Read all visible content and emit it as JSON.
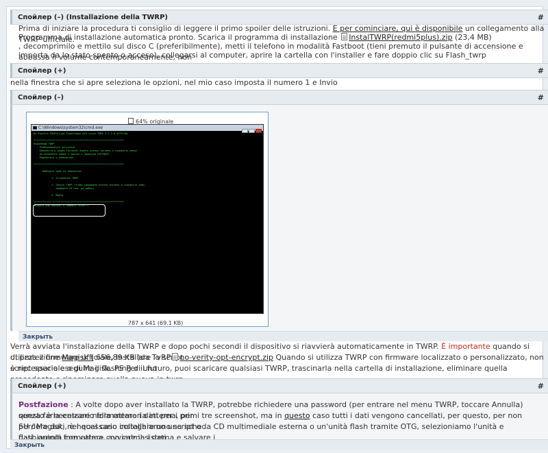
{
  "spoiler1": {
    "header": "Спойлер (–) (Installazione della TWRP)",
    "hash": "#",
    "line1_a": "Prima di iniziare la procedura ti consiglio di leggere il primo spoiler delle istruzioni. ",
    "line1_link": "E per cominciare, qui è disponibile",
    "line1_b": " un collegamento alla TWRP ufficiale.",
    "line2_a": "Programma di installazione automatica pronto. Scarica il programma di installazione ",
    "line2_file": "InstalTWRP(redmi5plus).zip",
    "line2_b": " (23,4 MB)",
    "line3": ", decomprimilo e mettilo sul disco C (preferibilmente), metti il telefono in modalità Fastboot (tieni premuto il pulsante di accensione e abbassa il volume contemporaneamente, non",
    "line4": "importa da lo stato spento o acceso), collegarsi al computer, aprire la cartella con l'installer e fare doppio clic su Flash_twrp"
  },
  "spoiler2": {
    "header": "Спойлер (+)",
    "hash": "#",
    "line1": "nella finestra che si apre seleziona le opzioni, nel mio caso imposta il numero 1 e Invio"
  },
  "spoiler3": {
    "header": "Спойлер (–)",
    "hash": "#",
    "zoom_label": "64% originale",
    "console_title": "C:\\Windows\\system32\\cmd.exe",
    "console_text": "By Faustus FDAXhinjoo Snapdragon 625 since TWRP 3.2.1-0 OFFICIAL\n\n*************************************************************\nПодробный TWRP\n  - Разблокировать загрузчик\n  - Перевести в режим Fastboot,Зажать кнопку питания и громкость минус\n    до появления зайца в ушанке с надписью FASTBOOT\n  - Подключить к компьютеру\n\n*************************************************************\n\n      Выберите один из вариантов:\n\n            1. Установить TWRP\n\n            2. Запуск TWRP (чтобы удерживая кнопки питания и громкость плюс,\n               примерно 10 сек. до вибро)\n\n            3. Выйти\n\n*************************************************************\nВведите ваш вариант и нажмите Enter:1",
    "dimensions": "787 x 641 (69.1 KB)",
    "close_label": "Закрыть"
  },
  "after_image": {
    "line1_a": "Verrà avviata l'installazione della TWRP e dopo pochi secondi il dispositivo si riavvierà automaticamente in TWRP. ",
    "line1_imp": "È importante",
    "line1_b": " quando si utilizza il firmware ufficiale, installare lo script",
    "line2_a": "di protezione ",
    "line2_magisk": "Magisk (",
    "line2_b": " 656,89 KB )da TvRP",
    "line2_file": "no-verity-opt-encrypt.zip",
    "line2_c": " Quando si utilizza TWRP con firmware localizzato o personalizzato, non è necessario eseguire il flashing di uno",
    "line3": "script speciale o di Magisk. PS Per il futuro, puoi scaricare qualsiasi TWRP, trascinarla nella cartella di installazione, eliminare quella precedente e rinominare quella nuova in twrp"
  },
  "spoiler4": {
    "header": "Спойлер (+)",
    "hash": "#",
    "postfazione": "Postfazione",
    "line1_a": " : A volte dopo aver installato la TWRP, potrebbe richiedere una password (per entrare nel menu TWRP, toccare Annulla) senza farla entrare nella memoria interna, per",
    "line2_a": "questo è necessario formattare i dati per i primi tre screenshot, ma in ",
    "line2_link": "questo",
    "line2_b": " caso tutti i dati vengono cancellati, per questo, per non perdere dati, è necessario installare uno script o",
    "line3": "SU / Magisk, nel qual caso colleghiamo una scheda CD multimediale esterna o un'unità flash tramite OTG, selezioniamo l'unità e flashiamola con calma, avviare il sistema e salvare i",
    "line4": "dati, quindi formattare con calma i dati",
    "close_label": "Закрыть"
  },
  "colors": {
    "important": "#d8241d",
    "postfazione": "#7a2a82",
    "console_green": "#3fd34a",
    "image_border": "#6aa2d6"
  },
  "icons": [
    "file-icon",
    "zoom-icon",
    "console-window-icon"
  ]
}
